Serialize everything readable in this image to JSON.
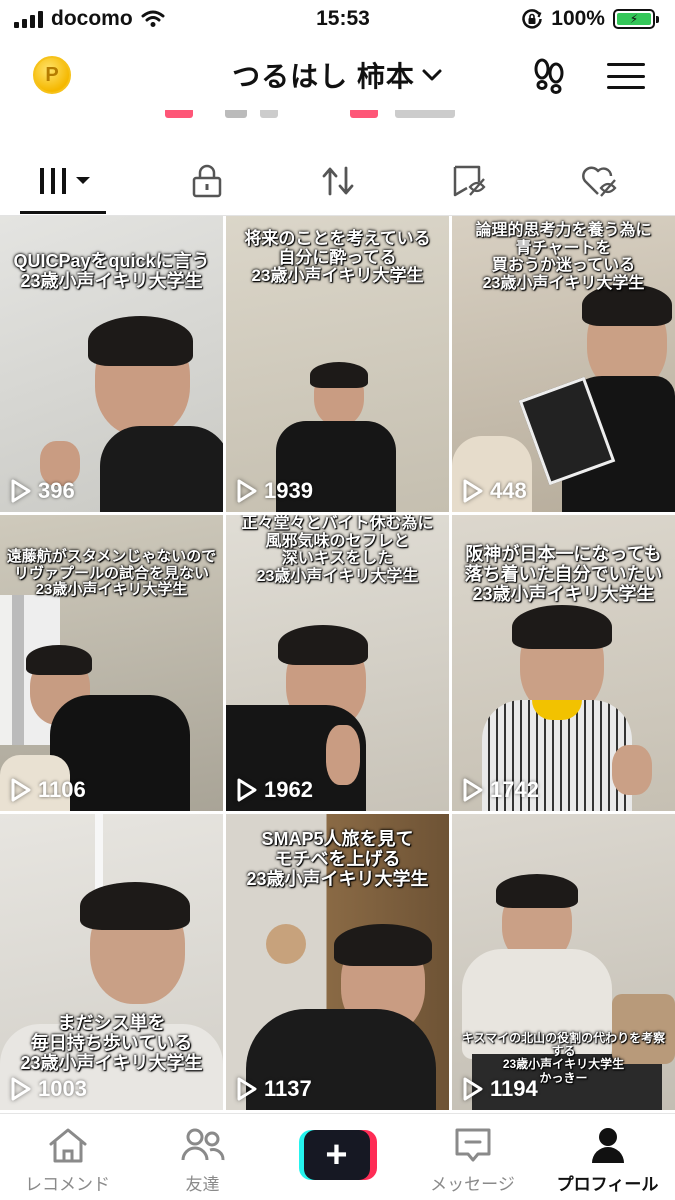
{
  "status_bar": {
    "carrier": "docomo",
    "time": "15:53",
    "battery": "100%"
  },
  "header": {
    "coin": "P",
    "title": "つるはし 柿本"
  },
  "tabs": [
    {
      "id": "videos",
      "icon": "grid-icon",
      "active": true
    },
    {
      "id": "private",
      "icon": "lock-icon"
    },
    {
      "id": "reposts",
      "icon": "repost-icon"
    },
    {
      "id": "favorites",
      "icon": "bookmark-icon"
    },
    {
      "id": "liked",
      "icon": "heart-icon"
    }
  ],
  "videos": [
    {
      "views": "396",
      "caption": "QUICPayをquickに言う\n23歳小声イキリ大学生",
      "bg": "#dcdcd8"
    },
    {
      "views": "1939",
      "caption": "将来のことを考えている\n自分に酔ってる\n23歳小声イキリ大学生",
      "bg": "#d3cdbf"
    },
    {
      "views": "448",
      "caption": "論理的思考力を養う為に\n青チャートを\n買おうか迷っている\n23歳小声イキリ大学生",
      "bg": "#cdc4b5"
    },
    {
      "views": "1106",
      "caption": "遠藤航がスタメンじゃないので\nリヴァプールの試合を見ない\n23歳小声イキリ大学生",
      "bg": "#c9c4b8"
    },
    {
      "views": "1962",
      "caption": "正々堂々とバイト休む為に\n風邪気味のセフレと\n深いキスをした\n23歳小声イキリ大学生",
      "bg": "#d9d5cc"
    },
    {
      "views": "1742",
      "caption": "阪神が日本一になっても\n落ち着いた自分でいたい\n23歳小声イキリ大学生",
      "bg": "#d8d3c8"
    },
    {
      "views": "1003",
      "caption": "まだシス単を\n毎日持ち歩いている\n23歳小声イキリ大学生",
      "bg": "#e3e1dc"
    },
    {
      "views": "1137",
      "caption": "SMAP5人旅を見て\nモチベを上げる\n23歳小声イキリ大学生",
      "bg": "#8a6a45"
    },
    {
      "views": "1194",
      "caption": "キスマイの北山の役割の代わりを考察する\n23歳小声イキリ大学生\nかっきー",
      "bg": "#d6d2ca"
    }
  ],
  "bottom_nav": [
    {
      "id": "home",
      "label": "レコメンド",
      "icon": "home-icon"
    },
    {
      "id": "friends",
      "label": "友達",
      "icon": "friends-icon"
    },
    {
      "id": "create",
      "label": "+",
      "icon": "plus-icon"
    },
    {
      "id": "inbox",
      "label": "メッセージ",
      "icon": "inbox-icon"
    },
    {
      "id": "profile",
      "label": "プロフィール",
      "icon": "profile-icon",
      "active": true
    }
  ],
  "colors": {
    "accent_pink": "#fe2c55",
    "accent_cyan": "#25f4ee",
    "dark": "#161823"
  }
}
